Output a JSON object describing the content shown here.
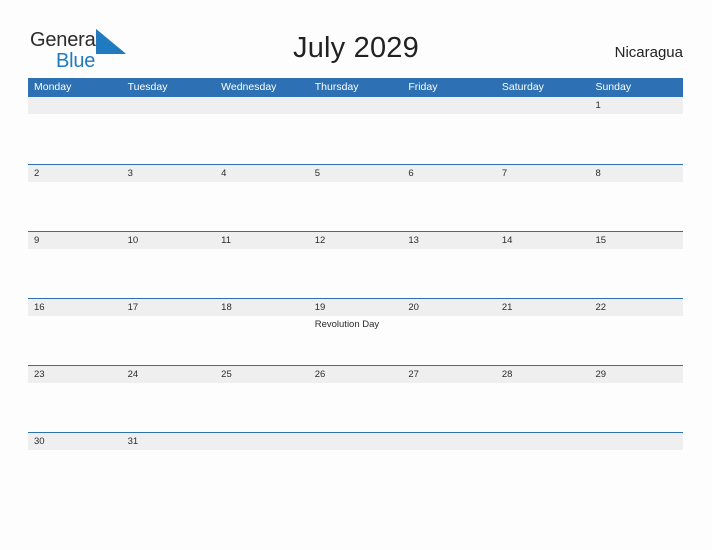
{
  "brand": {
    "logo_text_1": "General",
    "logo_text_2": "Blue",
    "mark_icon": "triangle-flag-icon",
    "accent_color": "#1f7ac0"
  },
  "header": {
    "title": "July 2029",
    "country": "Nicaragua"
  },
  "theme": {
    "header_blue": "#2d70b3",
    "band_gray": "#efefef",
    "text_dark": "#2b2b2b",
    "page_background": "#fdfdfd"
  },
  "calendar": {
    "weekdays": [
      "Monday",
      "Tuesday",
      "Wednesday",
      "Thursday",
      "Friday",
      "Saturday",
      "Sunday"
    ],
    "weeks": [
      {
        "days": [
          {
            "number": "",
            "events": []
          },
          {
            "number": "",
            "events": []
          },
          {
            "number": "",
            "events": []
          },
          {
            "number": "",
            "events": []
          },
          {
            "number": "",
            "events": []
          },
          {
            "number": "",
            "events": []
          },
          {
            "number": "1",
            "events": []
          }
        ]
      },
      {
        "days": [
          {
            "number": "2",
            "events": []
          },
          {
            "number": "3",
            "events": []
          },
          {
            "number": "4",
            "events": []
          },
          {
            "number": "5",
            "events": []
          },
          {
            "number": "6",
            "events": []
          },
          {
            "number": "7",
            "events": []
          },
          {
            "number": "8",
            "events": []
          }
        ]
      },
      {
        "days": [
          {
            "number": "9",
            "events": []
          },
          {
            "number": "10",
            "events": []
          },
          {
            "number": "11",
            "events": []
          },
          {
            "number": "12",
            "events": []
          },
          {
            "number": "13",
            "events": []
          },
          {
            "number": "14",
            "events": []
          },
          {
            "number": "15",
            "events": []
          }
        ]
      },
      {
        "days": [
          {
            "number": "16",
            "events": []
          },
          {
            "number": "17",
            "events": []
          },
          {
            "number": "18",
            "events": []
          },
          {
            "number": "19",
            "events": [
              "Revolution Day"
            ]
          },
          {
            "number": "20",
            "events": []
          },
          {
            "number": "21",
            "events": []
          },
          {
            "number": "22",
            "events": []
          }
        ]
      },
      {
        "days": [
          {
            "number": "23",
            "events": []
          },
          {
            "number": "24",
            "events": []
          },
          {
            "number": "25",
            "events": []
          },
          {
            "number": "26",
            "events": []
          },
          {
            "number": "27",
            "events": []
          },
          {
            "number": "28",
            "events": []
          },
          {
            "number": "29",
            "events": []
          }
        ]
      },
      {
        "days": [
          {
            "number": "30",
            "events": []
          },
          {
            "number": "31",
            "events": []
          },
          {
            "number": "",
            "events": []
          },
          {
            "number": "",
            "events": []
          },
          {
            "number": "",
            "events": []
          },
          {
            "number": "",
            "events": []
          },
          {
            "number": "",
            "events": []
          }
        ]
      }
    ]
  }
}
